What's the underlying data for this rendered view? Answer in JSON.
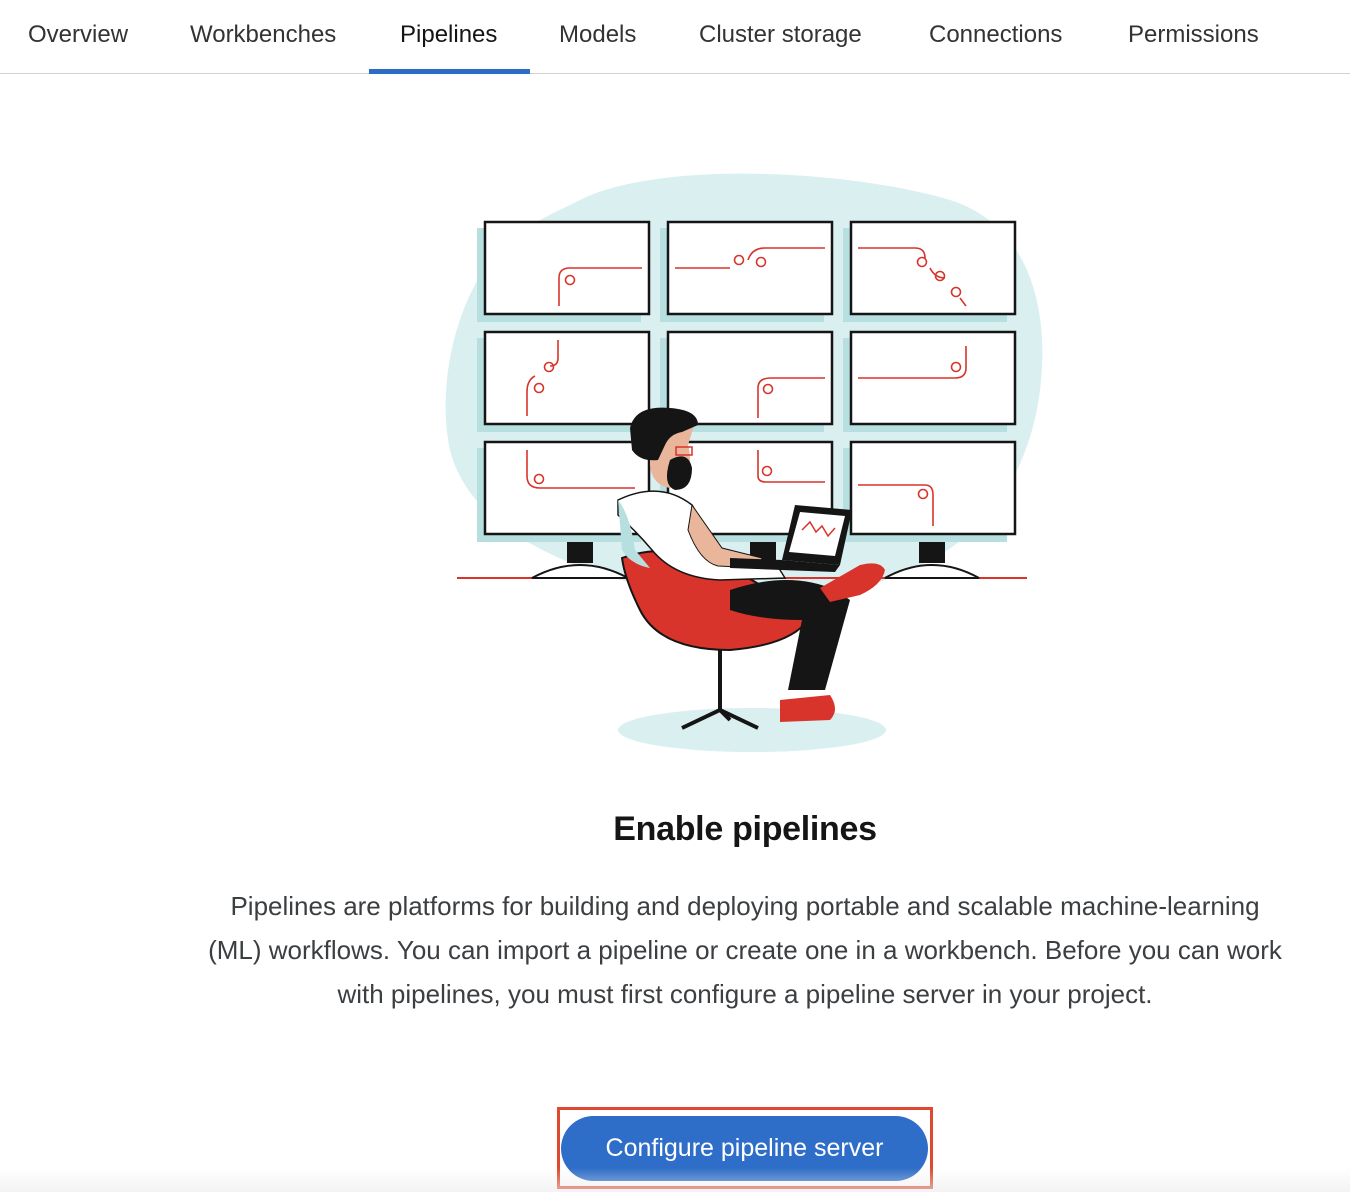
{
  "tabs": [
    {
      "label": "Overview"
    },
    {
      "label": "Workbenches"
    },
    {
      "label": "Pipelines"
    },
    {
      "label": "Models"
    },
    {
      "label": "Cluster storage"
    },
    {
      "label": "Connections"
    },
    {
      "label": "Permissions"
    }
  ],
  "active_tab": "Pipelines",
  "empty_state": {
    "title": "Enable pipelines",
    "description": "Pipelines are platforms for building and deploying portable and scalable machine-learning (ML) workflows. You can import a pipeline or create one in a workbench. Before you can work with pipelines, you must first configure a pipeline server in your project.",
    "button_label": "Configure pipeline server",
    "illustration_icon": "pipelines-illustration"
  },
  "colors": {
    "accent": "#2b6cc4",
    "button": "#2f6ec8",
    "highlight": "#e0492f",
    "illustration_red": "#d9342b",
    "illustration_teal": "#daeff0"
  }
}
